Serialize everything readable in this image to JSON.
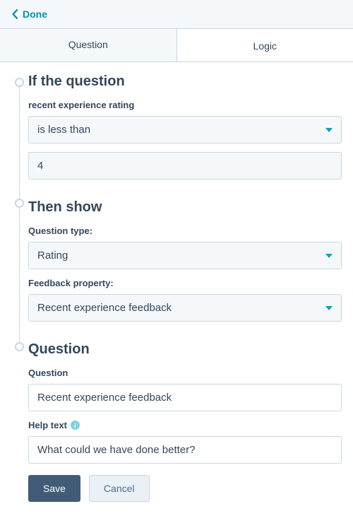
{
  "topbar": {
    "done": "Done"
  },
  "tabs": {
    "question": "Question",
    "logic": "Logic"
  },
  "sections": {
    "if": {
      "heading": "If the question",
      "conditionLabel": "recent experience rating",
      "operator": "is less than",
      "value": "4"
    },
    "then": {
      "heading": "Then show",
      "questionTypeLabel": "Question type:",
      "questionType": "Rating",
      "feedbackPropLabel": "Feedback property:",
      "feedbackProp": "Recent experience feedback"
    },
    "question": {
      "heading": "Question",
      "questionLabel": "Question",
      "questionValue": "Recent experience feedback",
      "helpLabel": "Help text",
      "helpValue": "What could we have done better?"
    }
  },
  "buttons": {
    "save": "Save",
    "cancel": "Cancel"
  }
}
